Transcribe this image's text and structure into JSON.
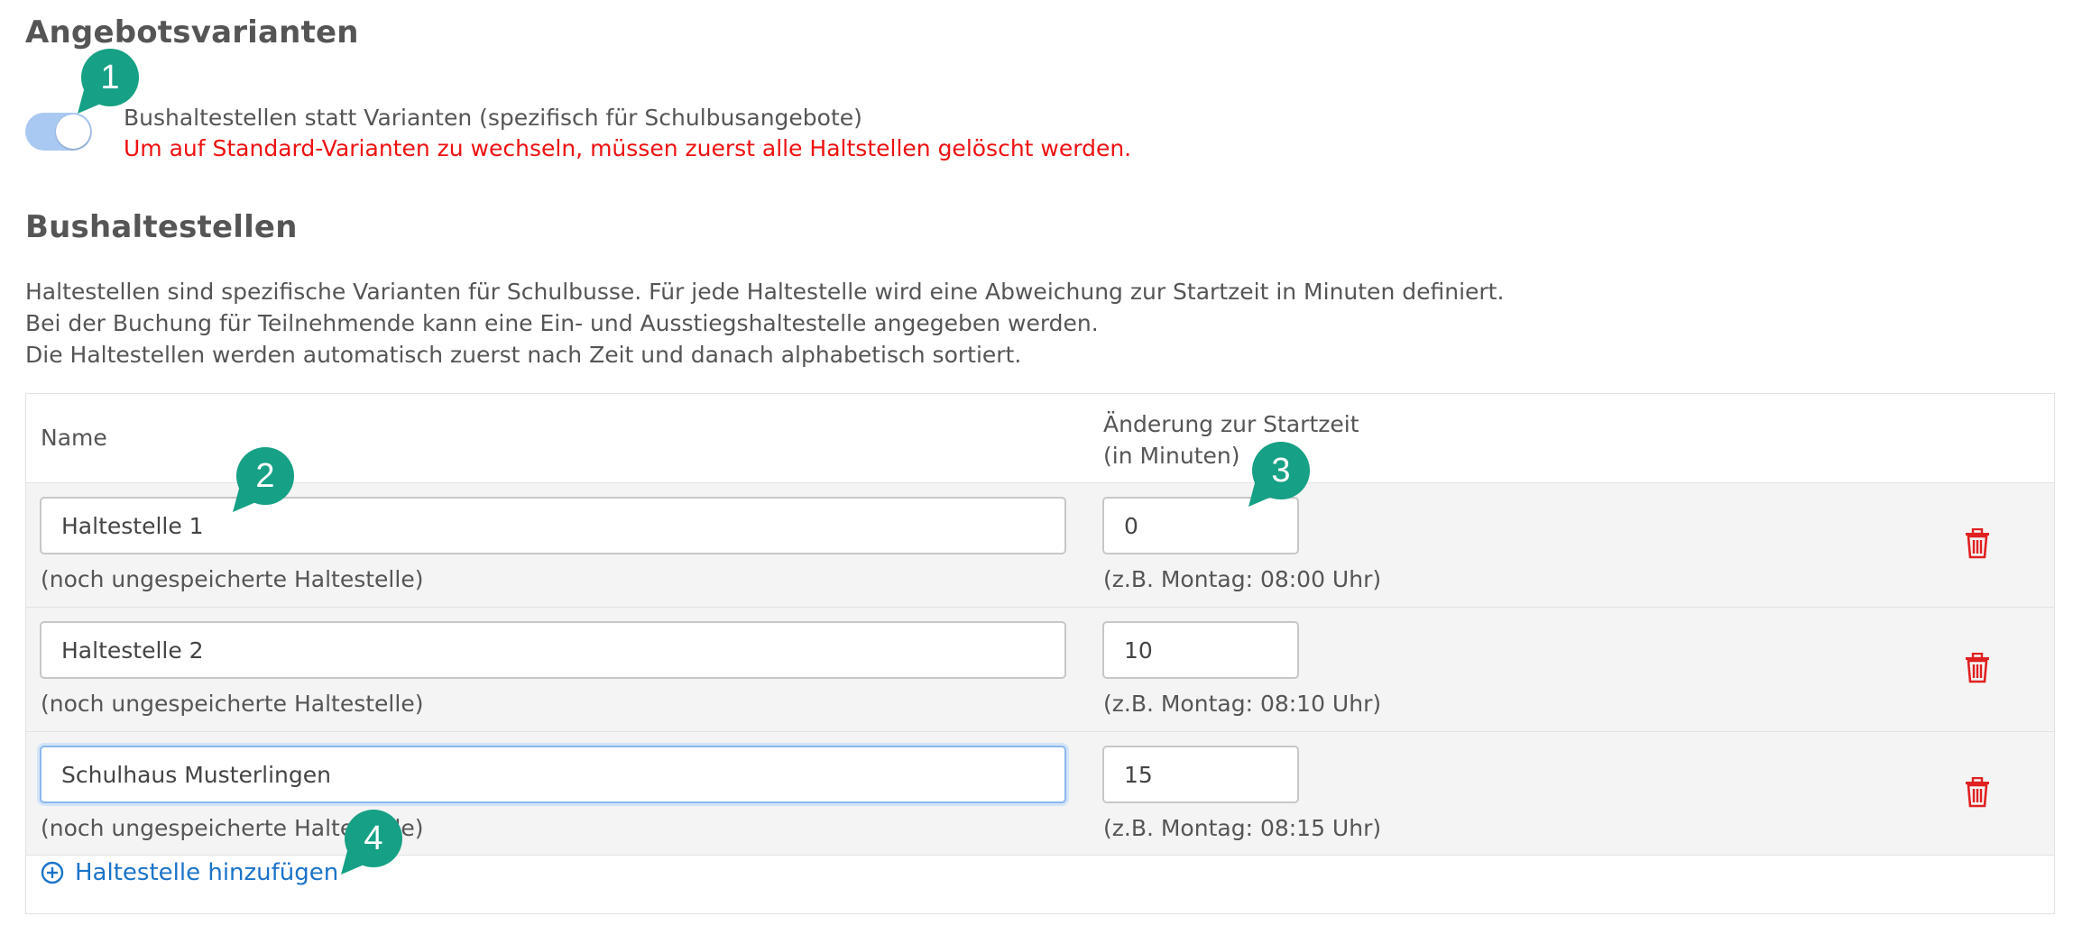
{
  "section_title": "Angebotsvarianten",
  "toggle": {
    "label": "Bushaltestellen statt Varianten (spezifisch für Schulbusangebote)",
    "warning": "Um auf Standard-Varianten zu wechseln, müssen zuerst alle Haltstellen gelöscht werden.",
    "enabled": true
  },
  "stops_title": "Bushaltestellen",
  "description": [
    "Haltestellen sind spezifische Varianten für Schulbusse. Für jede Haltestelle wird eine Abweichung zur Startzeit in Minuten definiert.",
    "Bei der Buchung für Teilnehmende kann eine Ein- und Ausstiegshaltestelle angegeben werden.",
    "Die Haltestellen werden automatisch zuerst nach Zeit und danach alphabetisch sortiert."
  ],
  "table": {
    "col_name": "Name",
    "col_change_line1": "Änderung zur Startzeit",
    "col_change_line2": "(in Minuten)",
    "rows": [
      {
        "name": "Haltestelle 1",
        "minutes": "0",
        "note": "(noch ungespeicherte Haltestelle)",
        "example": "(z.B. Montag: 08:00 Uhr)"
      },
      {
        "name": "Haltestelle 2",
        "minutes": "10",
        "note": "(noch ungespeicherte Haltestelle)",
        "example": "(z.B. Montag: 08:10 Uhr)"
      },
      {
        "name": "Schulhaus Musterlingen",
        "minutes": "15",
        "note": "(noch ungespeicherte Haltestelle)",
        "example": "(z.B. Montag: 08:15 Uhr)"
      }
    ],
    "add_label": "Haltestelle hinzufügen"
  },
  "badges": [
    "1",
    "2",
    "3",
    "4"
  ],
  "colors": {
    "badge": "#16a085",
    "warning": "#ee1111",
    "link": "#1a73c9",
    "trash": "#e02020",
    "toggle_on": "#a9c9f3"
  },
  "icons": {
    "delete": "trash-icon",
    "add": "plus-circle-icon"
  }
}
